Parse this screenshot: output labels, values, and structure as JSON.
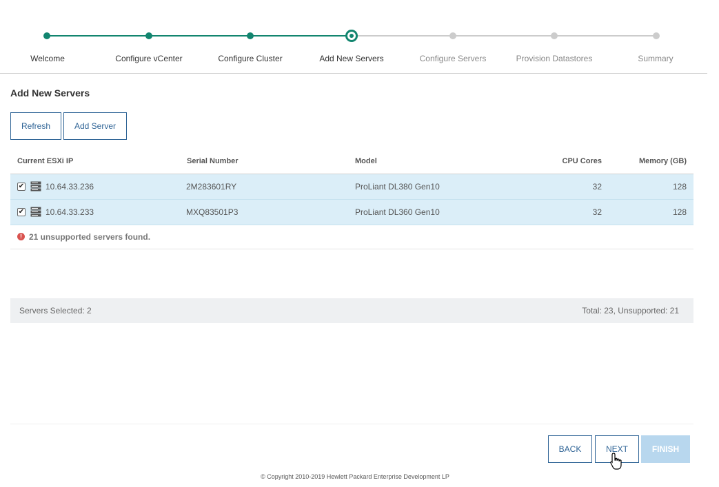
{
  "wizard": {
    "steps": [
      {
        "label": "Welcome",
        "state": "done"
      },
      {
        "label": "Configure vCenter",
        "state": "done"
      },
      {
        "label": "Configure Cluster",
        "state": "done"
      },
      {
        "label": "Add New Servers",
        "state": "current"
      },
      {
        "label": "Configure Servers",
        "state": "todo"
      },
      {
        "label": "Provision Datastores",
        "state": "todo"
      },
      {
        "label": "Summary",
        "state": "todo"
      }
    ]
  },
  "section": {
    "title": "Add New Servers",
    "refresh_label": "Refresh",
    "add_server_label": "Add Server"
  },
  "table": {
    "columns": [
      "Current ESXi IP",
      "Serial Number",
      "Model",
      "CPU Cores",
      "Memory (GB)"
    ],
    "rows": [
      {
        "ip": "10.64.33.236",
        "serial": "2M283601RY",
        "model": "ProLiant DL380 Gen10",
        "cpu": "32",
        "memory": "128",
        "checked": true
      },
      {
        "ip": "10.64.33.233",
        "serial": "MXQ83501P3",
        "model": "ProLiant DL360 Gen10",
        "cpu": "32",
        "memory": "128",
        "checked": true
      }
    ],
    "warning": "21 unsupported servers found."
  },
  "summary": {
    "selected": "Servers Selected: 2",
    "totals": "Total: 23, Unsupported: 21"
  },
  "nav": {
    "back_label": "BACK",
    "next_label": "NEXT",
    "finish_label": "FINISH"
  },
  "footer": {
    "copyright": "© Copyright 2010-2019 Hewlett Packard Enterprise Development LP"
  },
  "colors": {
    "accent": "#12856f",
    "link": "#2f6496",
    "row_selected": "#dbeef8",
    "warning": "#d9534f"
  }
}
